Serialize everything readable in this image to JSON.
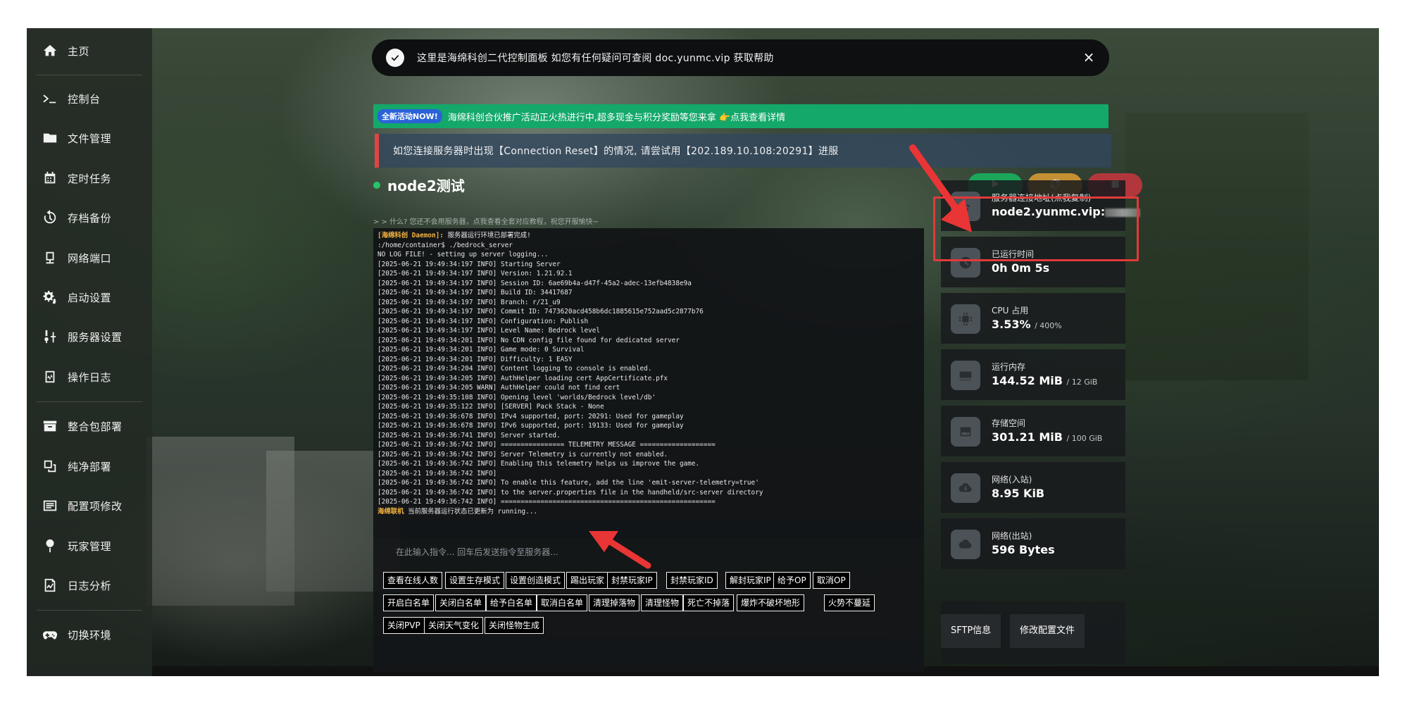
{
  "sidebar": {
    "items": [
      {
        "label": "主页",
        "icon": "home-icon"
      },
      {
        "label": "控制台",
        "icon": "terminal-icon"
      },
      {
        "label": "文件管理",
        "icon": "folder-icon"
      },
      {
        "label": "定时任务",
        "icon": "calendar-icon"
      },
      {
        "label": "存档备份",
        "icon": "history-icon"
      },
      {
        "label": "网络端口",
        "icon": "network-icon"
      },
      {
        "label": "启动设置",
        "icon": "gears-icon"
      },
      {
        "label": "服务器设置",
        "icon": "wrench-icon"
      },
      {
        "label": "操作日志",
        "icon": "log-icon"
      },
      {
        "label": "整合包部署",
        "icon": "archive-icon"
      },
      {
        "label": "纯净部署",
        "icon": "clone-icon"
      },
      {
        "label": "配置项修改",
        "icon": "list-icon"
      },
      {
        "label": "玩家管理",
        "icon": "pin-icon"
      },
      {
        "label": "日志分析",
        "icon": "chart-file-icon"
      },
      {
        "label": "切换环境",
        "icon": "gamepad-icon"
      }
    ]
  },
  "notice": {
    "text": "这里是海绵科创二代控制面板 如您有任何疑问可查阅 doc.yunmc.vip 获取帮助",
    "close": "×"
  },
  "promo": {
    "badge": "全新活动NOW!",
    "text": "海绵科创合伙推广活动正火热进行中,超多现金与积分奖励等您来拿 👉点我查看详情"
  },
  "warning": {
    "text": "如您连接服务器时出现【Connection Reset】的情况, 请尝试用【202.189.10.108:20291】进服"
  },
  "server": {
    "name": "node2测试",
    "hint": "> > 什么? 您还不会用服务器，点我查看全套对应教程，祝您开服愉快~"
  },
  "console": {
    "lines": [
      {
        "tag": "[海绵科创 Daemon]:",
        "text": " 服务器运行环境已部署完成!"
      },
      {
        "tag": "",
        "text": ":/home/container$ ./bedrock_server"
      },
      {
        "tag": "",
        "text": "NO LOG FILE! - setting up server logging..."
      },
      {
        "tag": "",
        "text": "[2025-06-21 19:49:34:197 INFO] Starting Server"
      },
      {
        "tag": "",
        "text": "[2025-06-21 19:49:34:197 INFO] Version: 1.21.92.1"
      },
      {
        "tag": "",
        "text": "[2025-06-21 19:49:34:197 INFO] Session ID: 6ae69b4a-d47f-45a2-adec-13efb4838e9a"
      },
      {
        "tag": "",
        "text": "[2025-06-21 19:49:34:197 INFO] Build ID: 34417687"
      },
      {
        "tag": "",
        "text": "[2025-06-21 19:49:34:197 INFO] Branch: r/21_u9"
      },
      {
        "tag": "",
        "text": "[2025-06-21 19:49:34:197 INFO] Commit ID: 7473620acd458b6dc1885615e752aad5c2877b76"
      },
      {
        "tag": "",
        "text": "[2025-06-21 19:49:34:197 INFO] Configuration: Publish"
      },
      {
        "tag": "",
        "text": "[2025-06-21 19:49:34:197 INFO] Level Name: Bedrock level"
      },
      {
        "tag": "",
        "text": "[2025-06-21 19:49:34:201 INFO] No CDN config file found for dedicated server"
      },
      {
        "tag": "",
        "text": "[2025-06-21 19:49:34:201 INFO] Game mode: 0 Survival"
      },
      {
        "tag": "",
        "text": "[2025-06-21 19:49:34:201 INFO] Difficulty: 1 EASY"
      },
      {
        "tag": "",
        "text": "[2025-06-21 19:49:34:204 INFO] Content logging to console is enabled."
      },
      {
        "tag": "",
        "text": "[2025-06-21 19:49:34:205 INFO] AuthHelper loading cert AppCertificate.pfx"
      },
      {
        "tag": "",
        "text": "[2025-06-21 19:49:34:205 WARN] AuthHelper could not find cert"
      },
      {
        "tag": "",
        "text": "[2025-06-21 19:49:35:108 INFO] Opening level 'worlds/Bedrock level/db'"
      },
      {
        "tag": "",
        "text": "[2025-06-21 19:49:35:122 INFO] [SERVER] Pack Stack - None"
      },
      {
        "tag": "",
        "text": "[2025-06-21 19:49:36:678 INFO] IPv4 supported, port: 20291: Used for gameplay"
      },
      {
        "tag": "",
        "text": "[2025-06-21 19:49:36:678 INFO] IPv6 supported, port: 19133: Used for gameplay"
      },
      {
        "tag": "",
        "text": "[2025-06-21 19:49:36:741 INFO] Server started."
      },
      {
        "tag": "",
        "text": "[2025-06-21 19:49:36:742 INFO] ================ TELEMETRY MESSAGE ==================="
      },
      {
        "tag": "",
        "text": "[2025-06-21 19:49:36:742 INFO] Server Telemetry is currently not enabled."
      },
      {
        "tag": "",
        "text": "[2025-06-21 19:49:36:742 INFO] Enabling this telemetry helps us improve the game."
      },
      {
        "tag": "",
        "text": "[2025-06-21 19:49:36:742 INFO]"
      },
      {
        "tag": "",
        "text": "[2025-06-21 19:49:36:742 INFO] To enable this feature, add the line 'emit-server-telemetry=true'"
      },
      {
        "tag": "",
        "text": "[2025-06-21 19:49:36:742 INFO] to the server.properties file in the handheld/src-server directory"
      },
      {
        "tag": "",
        "text": "[2025-06-21 19:49:36:742 INFO] ======================================================"
      },
      {
        "tag": "海绵联机",
        "text": " 当前服务器运行状态已更新为 running..."
      }
    ],
    "input_placeholder": "在此输入指令... 回车后发送指令至服务器..."
  },
  "quick_commands": [
    "查看在线人数",
    "设置生存模式",
    "设置创造模式",
    "踢出玩家",
    "封禁玩家IP",
    "封禁玩家ID",
    "解封玩家IP",
    "给予OP",
    "取消OP",
    "开启白名单",
    "关闭白名单",
    "给予白名单",
    "取消白名单",
    "清理掉落物",
    "清理怪物",
    "死亡不掉落",
    "爆炸不破坏地形",
    "火势不蔓延",
    "关闭PVP",
    "关闭天气变化",
    "关闭怪物生成"
  ],
  "stats": [
    {
      "label": "服务器连接地址(点我复制)",
      "value": "node2.yunmc.vip:",
      "sub": "",
      "icon": "wifi-icon"
    },
    {
      "label": "已运行时间",
      "value": "0h 0m 5s",
      "sub": "",
      "icon": "clock-icon"
    },
    {
      "label": "CPU 占用",
      "value": "3.53%",
      "sub": "/ 400%",
      "icon": "cpu-icon"
    },
    {
      "label": "运行内存",
      "value": "144.52 MiB",
      "sub": "/ 12 GiB",
      "icon": "memory-icon"
    },
    {
      "label": "存储空间",
      "value": "301.21 MiB",
      "sub": "/ 100 GiB",
      "icon": "hdd-icon"
    },
    {
      "label": "网络(入站)",
      "value": "8.95 KiB",
      "sub": "",
      "icon": "cloud-down-icon"
    },
    {
      "label": "网络(出站)",
      "value": "596 Bytes",
      "sub": "",
      "icon": "cloud-up-icon"
    }
  ],
  "actions": {
    "sftp": "SFTP信息",
    "config": "修改配置文件"
  },
  "colors": {
    "start": "#1ba65c",
    "restart": "#c49034",
    "stop": "#b2373c",
    "promo": "#14a86a",
    "highlight": "#e23a3a"
  }
}
